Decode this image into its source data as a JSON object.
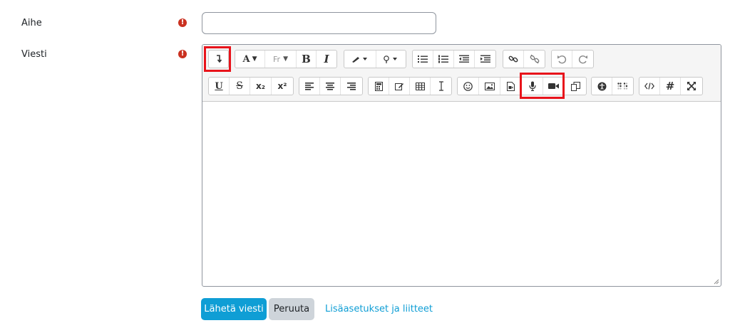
{
  "form": {
    "subject_label": "Aihe",
    "subject_value": "",
    "message_label": "Viesti",
    "required_icon": "exclamation-circle-icon"
  },
  "editor": {
    "row1": [
      {
        "name": "toggle-toolbar-button",
        "icon": "arrow-down-icon"
      },
      {
        "name": "font-button",
        "text": "A▾"
      },
      {
        "name": "paragraph-style-button",
        "text": "Fr▾"
      },
      {
        "name": "bold-button",
        "text": "B"
      },
      {
        "name": "italic-button",
        "text": "I"
      },
      {
        "name": "font-color-button",
        "icon": "brush-icon"
      },
      {
        "name": "background-color-button",
        "icon": "bulb-icon"
      },
      {
        "name": "unordered-list-button",
        "icon": "list-icon"
      },
      {
        "name": "ordered-list-button",
        "icon": "numbered-list-icon"
      },
      {
        "name": "outdent-button",
        "icon": "outdent-icon"
      },
      {
        "name": "indent-button",
        "icon": "indent-icon"
      },
      {
        "name": "link-button",
        "icon": "link-icon"
      },
      {
        "name": "unlink-button",
        "icon": "unlink-icon"
      },
      {
        "name": "undo-button",
        "icon": "undo-icon"
      },
      {
        "name": "redo-button",
        "icon": "redo-icon"
      }
    ],
    "row2_text": {
      "underline": "U",
      "strike": "S",
      "subscript": "x₂",
      "superscript": "x²",
      "hashtag": "#"
    }
  },
  "actions": {
    "submit_label": "Lähetä viesti",
    "cancel_label": "Peruuta",
    "advanced_link": "Lisäasetukset ja liitteet"
  },
  "colors": {
    "primary": "#0f9ed5",
    "secondary": "#ced4da",
    "required": "#ca3120",
    "highlight": "#e8131b"
  }
}
